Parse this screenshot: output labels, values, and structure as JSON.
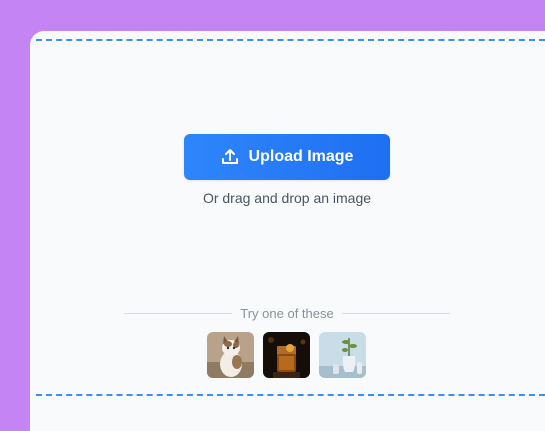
{
  "upload": {
    "button_label": "Upload Image",
    "icon": "upload-icon",
    "hint": "Or drag and drop an image"
  },
  "examples": {
    "heading": "Try one of these",
    "items": [
      {
        "name": "cat-photo",
        "depicts": "cat"
      },
      {
        "name": "drink-photo",
        "depicts": "cocktail glass"
      },
      {
        "name": "vase-photo",
        "depicts": "vase with plant"
      }
    ]
  },
  "colors": {
    "background": "#c584f4",
    "panel": "#f9fafb",
    "accent": "#2a80f8",
    "dash": "#3b8ff0"
  }
}
